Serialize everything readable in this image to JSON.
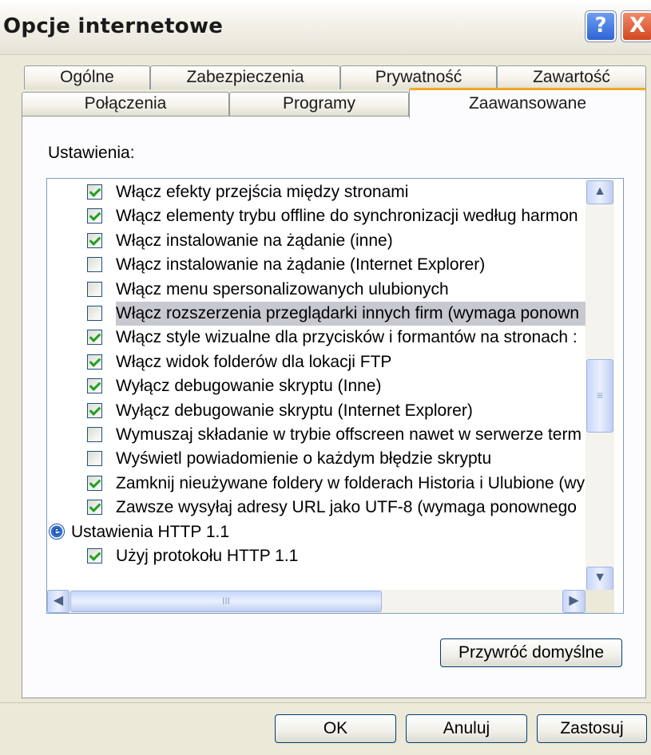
{
  "window": {
    "title": "Opcje internetowe",
    "help_glyph": "?",
    "close_glyph": "X"
  },
  "tabs": {
    "row1": [
      "Ogólne",
      "Zabezpieczenia",
      "Prywatność",
      "Zawartość"
    ],
    "row2": [
      "Połączenia",
      "Programy",
      "Zaawansowane"
    ],
    "active": "Zaawansowane"
  },
  "settings": {
    "label": "Ustawienia:",
    "items": [
      {
        "label": "Włącz efekty przejścia między stronami",
        "checked": true
      },
      {
        "label": "Włącz elementy trybu offline do synchronizacji według harmon",
        "checked": true
      },
      {
        "label": "Włącz instalowanie na żądanie (inne)",
        "checked": true
      },
      {
        "label": "Włącz instalowanie na żądanie (Internet Explorer)",
        "checked": false
      },
      {
        "label": "Włącz menu spersonalizowanych ulubionych",
        "checked": false
      },
      {
        "label": "Włącz rozszerzenia przeglądarki innych firm (wymaga ponown",
        "checked": false,
        "highlighted": true
      },
      {
        "label": "Włącz style wizualne dla przycisków i formantów na stronach :",
        "checked": true
      },
      {
        "label": "Włącz widok folderów dla lokacji FTP",
        "checked": true
      },
      {
        "label": "Wyłącz debugowanie skryptu (Inne)",
        "checked": true
      },
      {
        "label": "Wyłącz debugowanie skryptu (Internet Explorer)",
        "checked": true
      },
      {
        "label": "Wymuszaj składanie w trybie offscreen nawet w serwerze term",
        "checked": false
      },
      {
        "label": "Wyświetl powiadomienie o każdym błędzie skryptu",
        "checked": false
      },
      {
        "label": "Zamknij nieużywane foldery w folderach Historia i Ulubione (wy",
        "checked": true
      },
      {
        "label": "Zawsze wysyłaj adresy URL jako UTF-8 (wymaga ponownego",
        "checked": true
      }
    ],
    "group": {
      "label": "Ustawienia HTTP 1.1",
      "icon": "ie-icon"
    },
    "group_items": [
      {
        "label": "Użyj protokołu HTTP 1.1",
        "checked": true
      }
    ]
  },
  "scrollbar": {
    "up": "▲",
    "down": "▼",
    "left": "◀",
    "right": "▶",
    "v_grip": "≡",
    "h_grip": "III"
  },
  "buttons": {
    "restore": "Przywróć domyślne",
    "ok": "OK",
    "cancel": "Anuluj",
    "apply": "Zastosuj"
  }
}
